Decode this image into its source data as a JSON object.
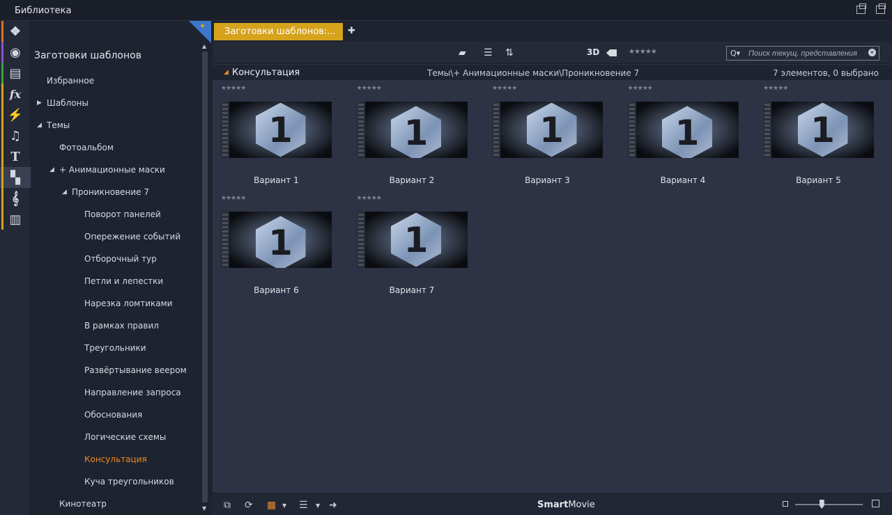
{
  "window": {
    "title": "Библиотека"
  },
  "iconstrip": [
    {
      "icon": "media-box-icon",
      "glyph": "❖",
      "color": "#e07020"
    },
    {
      "icon": "film-reel-icon",
      "glyph": "◉",
      "color": "#8a4fd0"
    },
    {
      "icon": "projects-icon",
      "glyph": "▤",
      "color": "#3aa040"
    },
    {
      "icon": "effects-icon",
      "glyph": "fx",
      "color": "#d6a31c"
    },
    {
      "icon": "transitions-icon",
      "glyph": "⚡",
      "color": "#d6a31c"
    },
    {
      "icon": "music-icon",
      "glyph": "♫",
      "color": "#d6a31c"
    },
    {
      "icon": "title-icon",
      "glyph": "T",
      "color": "#d6a31c"
    },
    {
      "icon": "templates-icon",
      "glyph": "▚",
      "color": "#d6a31c"
    },
    {
      "icon": "score-icon",
      "glyph": "𝄞",
      "color": "#d6a31c"
    },
    {
      "icon": "piano-icon",
      "glyph": "▥",
      "color": "#d6a31c"
    }
  ],
  "tree": {
    "heading": "Заготовки шаблонов",
    "items": [
      {
        "label": "Избранное",
        "indent": 0,
        "expander": ""
      },
      {
        "label": "Шаблоны",
        "indent": 0,
        "expander": "▶"
      },
      {
        "label": "Темы",
        "indent": 0,
        "expander": "◢"
      },
      {
        "label": "Фотоальбом",
        "indent": 1,
        "expander": ""
      },
      {
        "label": "+ Анимационные маски",
        "indent": 1,
        "expander": "◢"
      },
      {
        "label": "Проникновение 7",
        "indent": 2,
        "expander": "◢"
      },
      {
        "label": "Поворот панелей",
        "indent": 3,
        "expander": ""
      },
      {
        "label": "Опережение событий",
        "indent": 3,
        "expander": ""
      },
      {
        "label": "Отборочный тур",
        "indent": 3,
        "expander": ""
      },
      {
        "label": "Петли и лепестки",
        "indent": 3,
        "expander": ""
      },
      {
        "label": "Нарезка ломтиками",
        "indent": 3,
        "expander": ""
      },
      {
        "label": "В рамках правил",
        "indent": 3,
        "expander": ""
      },
      {
        "label": "Треугольники",
        "indent": 3,
        "expander": ""
      },
      {
        "label": "Развёртывание веером",
        "indent": 3,
        "expander": ""
      },
      {
        "label": "Направление запроса",
        "indent": 3,
        "expander": ""
      },
      {
        "label": "Обоснования",
        "indent": 3,
        "expander": ""
      },
      {
        "label": "Логические схемы",
        "indent": 3,
        "expander": ""
      },
      {
        "label": "Консультация",
        "indent": 3,
        "expander": "",
        "selected": true
      },
      {
        "label": "Куча треугольников",
        "indent": 3,
        "expander": ""
      },
      {
        "label": "Кинотеатр",
        "indent": 1,
        "expander": ""
      }
    ]
  },
  "tabs": {
    "active_label": "Заготовки шаблонов:...",
    "add_icon": "add-tab-icon"
  },
  "toolbar": {
    "folder_icon": "▰",
    "view_icon": "☰",
    "sort_icon": "⇅",
    "three_d": "3D",
    "rating_stars": "★★★★★",
    "search_placeholder": "Поиск текущ. представления",
    "search_glyph": "Q▾",
    "clear_glyph": "✕"
  },
  "infobar": {
    "title": "Консультация",
    "path": "Темы\\+ Анимационные маски\\Проникновение 7",
    "count": "7 элементов, 0 выбрано",
    "arrow": "◢"
  },
  "items": [
    {
      "label": "Вариант 1",
      "stars": "★★★★★",
      "digit": "1"
    },
    {
      "label": "Вариант 2",
      "stars": "★★★★★",
      "digit": "1"
    },
    {
      "label": "Вариант 3",
      "stars": "★★★★★",
      "digit": "1"
    },
    {
      "label": "Вариант 4",
      "stars": "★★★★★",
      "digit": "1"
    },
    {
      "label": "Вариант 5",
      "stars": "★★★★★",
      "digit": "1"
    },
    {
      "label": "Вариант 6",
      "stars": "★★★★★",
      "digit": "1"
    },
    {
      "label": "Вариант 7",
      "stars": "★★★★★",
      "digit": "1"
    }
  ],
  "bottombar": {
    "brand_bold": "Smart",
    "brand_regular": "Movie",
    "icons": {
      "copy": "⧉",
      "refresh": "⟳",
      "grid": "▦",
      "list": "☰",
      "export": "➜"
    },
    "zoom_level": 0.4
  }
}
